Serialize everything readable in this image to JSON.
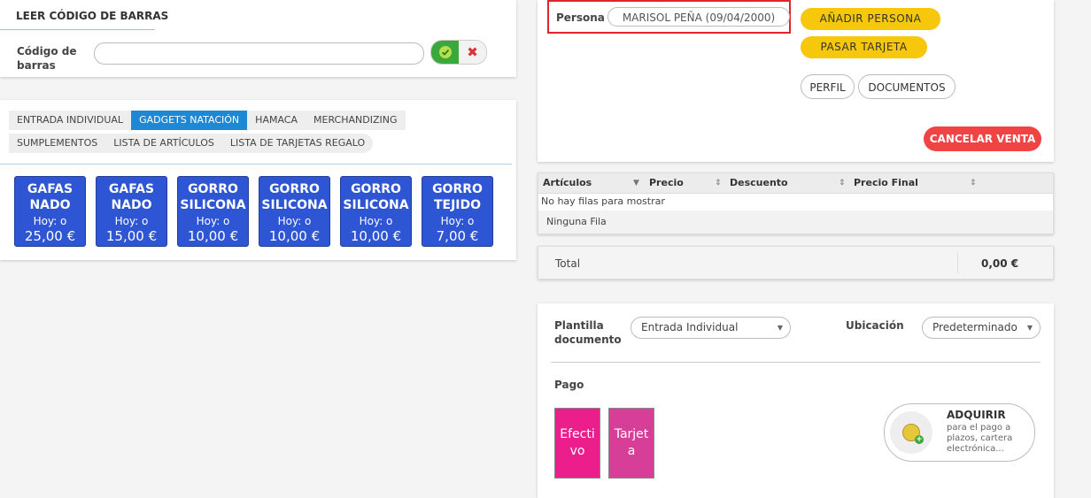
{
  "barcode": {
    "title": "LEER CÓDIGO DE BARRAS",
    "label": "Código de barras",
    "input_value": "",
    "confirm_icon": "check-icon",
    "cancel_icon": "close-icon",
    "cancel_glyph": "✖"
  },
  "tabs": [
    {
      "label": "ENTRADA INDIVIDUAL",
      "active": false
    },
    {
      "label": "GADGETS NATACIÓN",
      "active": true
    },
    {
      "label": "HAMACA",
      "active": false
    },
    {
      "label": "MERCHANDIZING",
      "active": false
    },
    {
      "label": "SUMPLEMENTOS",
      "active": false
    },
    {
      "label": "LISTA DE ARTÍCULOS",
      "active": false
    },
    {
      "label": "LISTA DE TARJETAS REGALO",
      "active": false
    }
  ],
  "products": [
    {
      "name": "GAFAS NADO",
      "today": "Hoy: o",
      "price": "25,00 €"
    },
    {
      "name": "GAFAS NADO",
      "today": "Hoy: o",
      "price": "15,00 €"
    },
    {
      "name": "GORRO SILICONA",
      "today": "Hoy: o",
      "price": "10,00 €"
    },
    {
      "name": "GORRO SILICONA",
      "today": "Hoy: o",
      "price": "10,00 €"
    },
    {
      "name": "GORRO SILICONA",
      "today": "Hoy: o",
      "price": "10,00 €"
    },
    {
      "name": "GORRO TEJIDO",
      "today": "Hoy: o",
      "price": "7,00 €"
    }
  ],
  "persona": {
    "label": "Persona",
    "value": "MARISOL PEÑA (09/04/2000)",
    "add_button": "AÑADIR PERSONA",
    "card_button": "PASAR TARJETA",
    "profile_button": "PERFIL",
    "documents_button": "DOCUMENTOS",
    "cancel_sale_button": "CANCELAR VENTA"
  },
  "articles_table": {
    "columns": [
      "Artículos",
      "Precio",
      "Descuento",
      "Precio Final"
    ],
    "sort_icons": [
      "▼",
      "⇕",
      "⇕",
      "⇕"
    ],
    "empty_message": "No hay filas para mostrar",
    "footer": "Ninguna Fila"
  },
  "total": {
    "label": "Total",
    "value": "0,00 €"
  },
  "document": {
    "template_label": "Plantilla documento",
    "template_value": "Entrada Individual",
    "location_label": "Ubicación",
    "location_value": "Predeterminado",
    "dropdown_glyph": "▼"
  },
  "payment": {
    "title": "Pago",
    "methods": [
      {
        "label": "Efecti vo",
        "color": "#ec1e8c"
      },
      {
        "label": "Tarjet a",
        "color": "#d63e97"
      }
    ],
    "acquire": {
      "title": "ADQUIRIR",
      "description": "para el pago a plazos, cartera electrónica...",
      "icon": "coin-add-icon",
      "badge_glyph": "+"
    }
  }
}
